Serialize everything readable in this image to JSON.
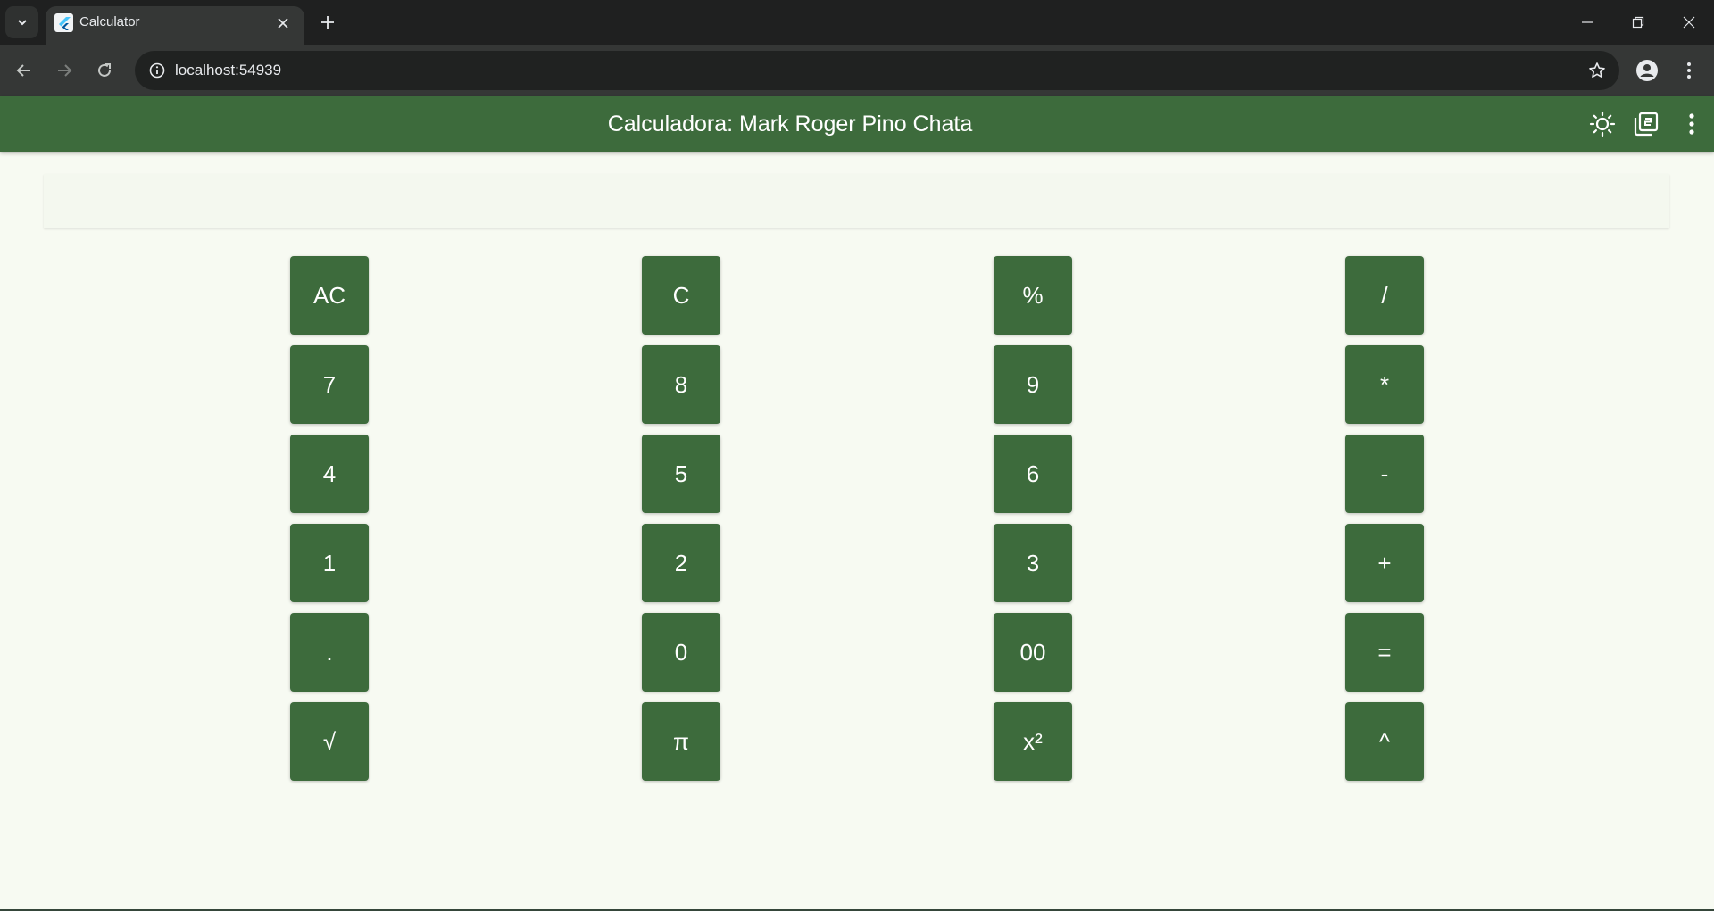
{
  "browser": {
    "tab_title": "Calculator",
    "url": "localhost:54939",
    "icons": {
      "tab_search": "chevron-down-icon",
      "tab_close": "close-icon",
      "new_tab": "plus-icon",
      "back": "arrow-left-icon",
      "forward": "arrow-right-icon",
      "reload": "reload-icon",
      "site_info": "info-icon",
      "bookmark": "star-icon",
      "profile": "person-icon",
      "menu": "vertical-dots-icon",
      "minimize": "minimize-icon",
      "restore": "restore-icon",
      "close_window": "close-icon"
    }
  },
  "app": {
    "title": "Calculadora: Mark Roger Pino Chata",
    "display_value": "",
    "colors": {
      "primary": "#3d6b3c",
      "background": "#f7faf2",
      "on_primary": "#ffffff"
    },
    "actions": {
      "theme": "sun-icon",
      "history": "library-icon",
      "more": "vertical-dots-icon"
    },
    "keys": [
      [
        "AC",
        "C",
        "%",
        "/"
      ],
      [
        "7",
        "8",
        "9",
        "*"
      ],
      [
        "4",
        "5",
        "6",
        "-"
      ],
      [
        "1",
        "2",
        "3",
        "+"
      ],
      [
        ".",
        "0",
        "00",
        "="
      ],
      [
        "√",
        "π",
        "x²",
        "^"
      ]
    ]
  }
}
